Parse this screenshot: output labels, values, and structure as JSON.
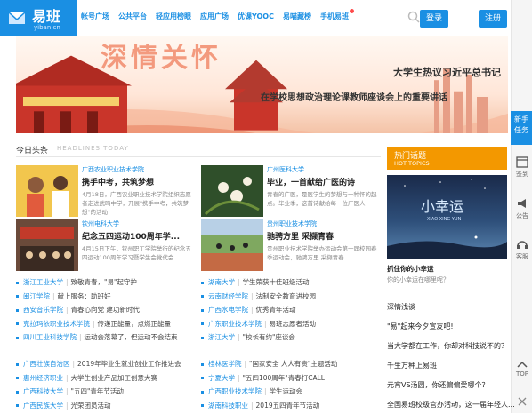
{
  "brand": {
    "name_cn": "易班",
    "name_en": "yiban.cn",
    "color": "#1a8fe3"
  },
  "nav": [
    {
      "label": "帐号广场"
    },
    {
      "label": "公共平台"
    },
    {
      "label": "轻应用榜眼"
    },
    {
      "label": "应用广场"
    },
    {
      "label": "优课YOOC"
    },
    {
      "label": "易喵藏榜"
    },
    {
      "label": "手机易班"
    }
  ],
  "auth": {
    "login": "登录",
    "register": "注册"
  },
  "banner": {
    "big_text": "深情关怀",
    "line1": "大学生热议习近平总书记",
    "line2": "在学校思想政治理论课教师座谈会上的重要讲话"
  },
  "rail": {
    "new_task": "新手任务",
    "sign": "签到",
    "notice": "公告",
    "service": "客服",
    "top": "TOP"
  },
  "headlines": {
    "title": "今日头条",
    "title_en": "HEADLINES TODAY",
    "cards": [
      {
        "school": "广西农业职业技术学院",
        "title": "携手中考，共筑梦想",
        "desc": "4月18日，广西农业职业技术学院组织志愿者走进武鸣中学，开展\"携手中考，共筑梦想\"的活动"
      },
      {
        "school": "广州医科大学",
        "title": "毕业，一首献给广医的诗",
        "desc": "青春的广医，是医学生的梦想与一种怀的起点。毕业季，这首诗献给每一位广医人"
      },
      {
        "school": "钦州电科大学",
        "title": "纪念五四运动100周年学...",
        "desc": "4月15日下午，钦州职工学院举行的纪念五四运动100周年学习暨学生会党代会"
      },
      {
        "school": "贵州职业技术学院",
        "title": "驰骋方里 采撷青春",
        "desc": "贵州职业技术学院举办运动会第一届校园春季运动会，驰骋方里 采撷青春"
      }
    ],
    "list_left": [
      {
        "school": "浙江工业大学",
        "text": "致敬青春，\"易\"起守护"
      },
      {
        "school": "闽江学院",
        "text": "献上服务：助班好"
      },
      {
        "school": "西安音乐学院",
        "text": "青春心向党 建功新时代"
      },
      {
        "school": "克拉玛依职业技术学院",
        "text": "传递正能量，点燃正能量"
      },
      {
        "school": "四川工业科技学院",
        "text": "运动会落幕了，但运动不会结束"
      }
    ],
    "list_right": [
      {
        "school": "湖南大学",
        "text": "学生荣获十佳班级活动"
      },
      {
        "school": "云南财经学院",
        "text": "法制安全教育进校园"
      },
      {
        "school": "广西水电学院",
        "text": "优秀青年活动"
      },
      {
        "school": "广东职业技术学院",
        "text": "易班志愿者活动"
      },
      {
        "school": "浙江大学",
        "text": "\"校长有约\"座谈会"
      }
    ],
    "list2_left": [
      {
        "school": "广西壮族自治区",
        "text": "2019年毕业生就业创业工作推进会"
      },
      {
        "school": "惠州经济职业",
        "text": "大学生创业产品加工创意大赛"
      },
      {
        "school": "广西科技大学",
        "text": "\"五四\"青年节活动"
      },
      {
        "school": "广西民族大学",
        "text": "光荣团员活动"
      }
    ],
    "list2_right": [
      {
        "school": "桂林医学院",
        "text": "\"国家安全 人人有责\"主题活动"
      },
      {
        "school": "宁夏大学",
        "text": "\"五四100周年\"青春打CALL"
      },
      {
        "school": "广西职业技术学院",
        "text": "学生运动会"
      },
      {
        "school": "湖南科技职业",
        "text": "2019五四青年节活动"
      }
    ]
  },
  "hot": {
    "title": "热门话题",
    "title_en": "HOT TOPICS",
    "image_text": "小幸运",
    "image_sub": "XIAO XING YUN",
    "caption": "抓住你的小幸运",
    "subcaption": "你的小幸运在哪里呢？",
    "topics": [
      "深情浅谈",
      "\"易\"起来今夕宣友吧!",
      "当大学都在工作，你却对科技说不的？",
      "千生万种上易班",
      "元宵VS汤圆，你还偏偏爱哪个？",
      "全国易班校级官办活动，这一届年轻人..."
    ]
  },
  "colors": {
    "accent": "#1a8fe3",
    "hot": "#f39800"
  }
}
